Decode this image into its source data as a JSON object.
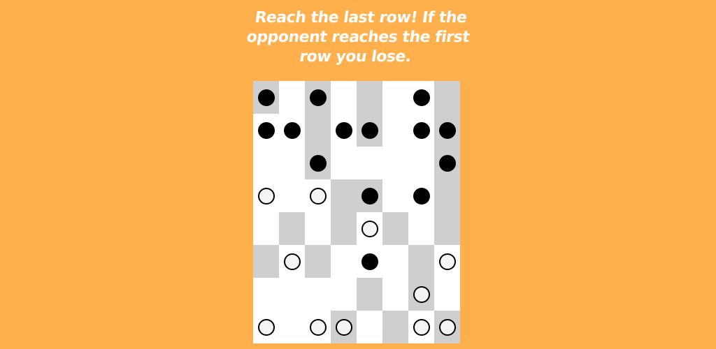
{
  "page": {
    "background": "#ffb04d",
    "instructions": "Reach the last row! If the opponent reaches the first row you lose."
  },
  "board": {
    "rows": 8,
    "cols": 8,
    "light_color": "#ffffff",
    "dark_color": "#cfcfcf",
    "shading": [
      "10101001",
      "00101001",
      "00100001",
      "00011001",
      "01010101",
      "10100010",
      "00001010",
      "00010101"
    ],
    "pieces": [
      "B.B...B.",
      "BB.BB.BB",
      "..B....B",
      "W.W.B.B.",
      "....W...",
      ".W..B..W",
      "......W.",
      "W.WW..WW"
    ],
    "black_piece_color": "#000000",
    "white_piece_color": "#f4f4f4"
  }
}
